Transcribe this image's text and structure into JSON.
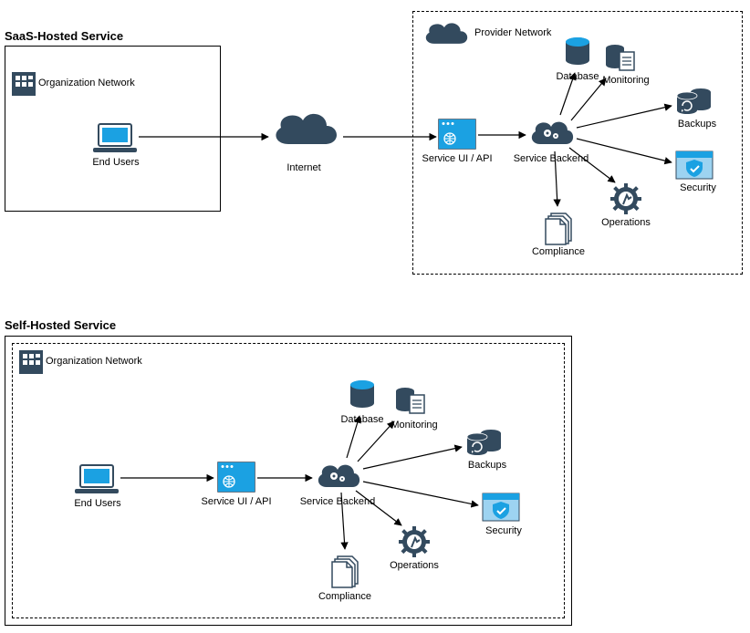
{
  "saas": {
    "title": "SaaS-Hosted Service",
    "org_network_label": "Organization Network",
    "provider_network_label": "Provider Network",
    "end_users_label": "End Users",
    "internet_label": "Internet",
    "service_ui_label": "Service UI / API",
    "backend_label": "Service Backend",
    "database_label": "Database",
    "monitoring_label": "Monitoring",
    "backups_label": "Backups",
    "security_label": "Security",
    "operations_label": "Operations",
    "compliance_label": "Compliance"
  },
  "self": {
    "title": "Self-Hosted Service",
    "org_network_label": "Organization Network",
    "end_users_label": "End Users",
    "service_ui_label": "Service UI / API",
    "backend_label": "Service Backend",
    "database_label": "Database",
    "monitoring_label": "Monitoring",
    "backups_label": "Backups",
    "security_label": "Security",
    "operations_label": "Operations",
    "compliance_label": "Compliance"
  },
  "colors": {
    "dark": "#334a5e",
    "blue": "#1ba1e2"
  }
}
